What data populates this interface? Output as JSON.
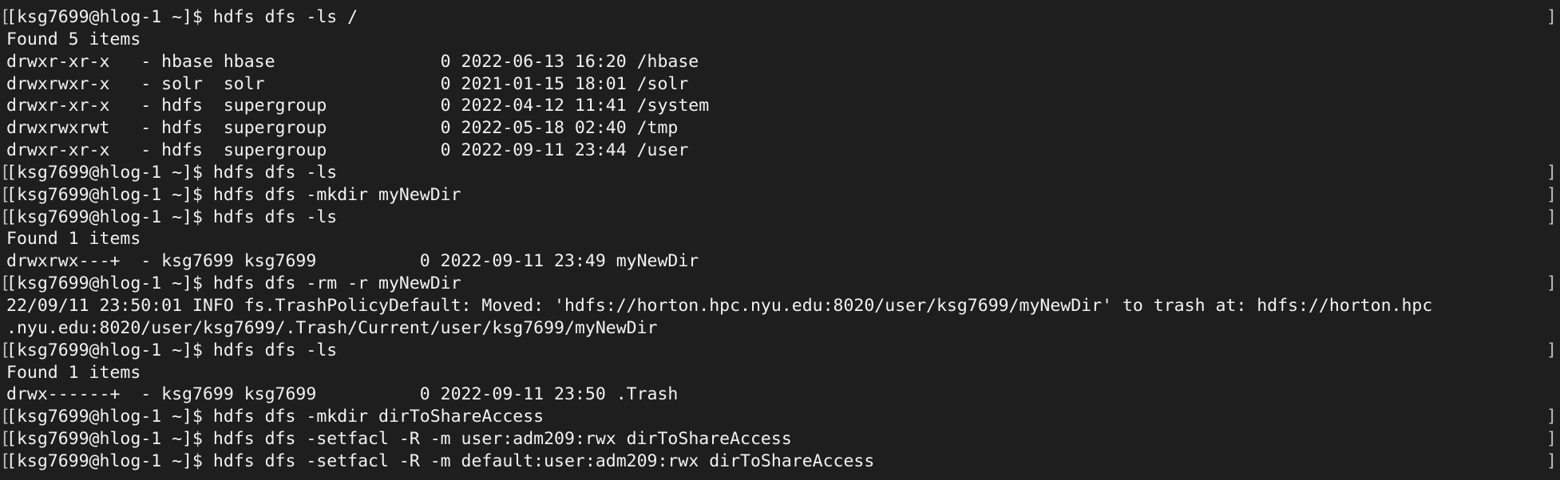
{
  "terminal": {
    "lines": [
      {
        "type": "prompt",
        "prompt": "[ksg7699@hlog-1 ~]$ ",
        "command": "hdfs dfs -ls /"
      },
      {
        "type": "output",
        "text": "Found 5 items"
      },
      {
        "type": "output",
        "text": "drwxr-xr-x   - hbase hbase                0 2022-06-13 16:20 /hbase"
      },
      {
        "type": "output",
        "text": "drwxrwxr-x   - solr  solr                 0 2021-01-15 18:01 /solr"
      },
      {
        "type": "output",
        "text": "drwxr-xr-x   - hdfs  supergroup           0 2022-04-12 11:41 /system"
      },
      {
        "type": "output",
        "text": "drwxrwxrwt   - hdfs  supergroup           0 2022-05-18 02:40 /tmp"
      },
      {
        "type": "output",
        "text": "drwxr-xr-x   - hdfs  supergroup           0 2022-09-11 23:44 /user"
      },
      {
        "type": "prompt",
        "prompt": "[ksg7699@hlog-1 ~]$ ",
        "command": "hdfs dfs -ls"
      },
      {
        "type": "prompt",
        "prompt": "[ksg7699@hlog-1 ~]$ ",
        "command": "hdfs dfs -mkdir myNewDir"
      },
      {
        "type": "prompt",
        "prompt": "[ksg7699@hlog-1 ~]$ ",
        "command": "hdfs dfs -ls"
      },
      {
        "type": "output",
        "text": "Found 1 items"
      },
      {
        "type": "output",
        "text": "drwxrwx---+  - ksg7699 ksg7699          0 2022-09-11 23:49 myNewDir"
      },
      {
        "type": "prompt",
        "prompt": "[ksg7699@hlog-1 ~]$ ",
        "command": "hdfs dfs -rm -r myNewDir"
      },
      {
        "type": "output",
        "text": "22/09/11 23:50:01 INFO fs.TrashPolicyDefault: Moved: 'hdfs://horton.hpc.nyu.edu:8020/user/ksg7699/myNewDir' to trash at: hdfs://horton.hpc"
      },
      {
        "type": "output",
        "text": ".nyu.edu:8020/user/ksg7699/.Trash/Current/user/ksg7699/myNewDir"
      },
      {
        "type": "prompt",
        "prompt": "[ksg7699@hlog-1 ~]$ ",
        "command": "hdfs dfs -ls"
      },
      {
        "type": "output",
        "text": "Found 1 items"
      },
      {
        "type": "output",
        "text": "drwx------+  - ksg7699 ksg7699          0 2022-09-11 23:50 .Trash"
      },
      {
        "type": "prompt",
        "prompt": "[ksg7699@hlog-1 ~]$ ",
        "command": "hdfs dfs -mkdir dirToShareAccess"
      },
      {
        "type": "prompt",
        "prompt": "[ksg7699@hlog-1 ~]$ ",
        "command": "hdfs dfs -setfacl -R -m user:adm209:rwx dirToShareAccess"
      },
      {
        "type": "prompt",
        "prompt": "[ksg7699@hlog-1 ~]$ ",
        "command": "hdfs dfs -setfacl -R -m default:user:adm209:rwx dirToShareAccess"
      }
    ]
  }
}
